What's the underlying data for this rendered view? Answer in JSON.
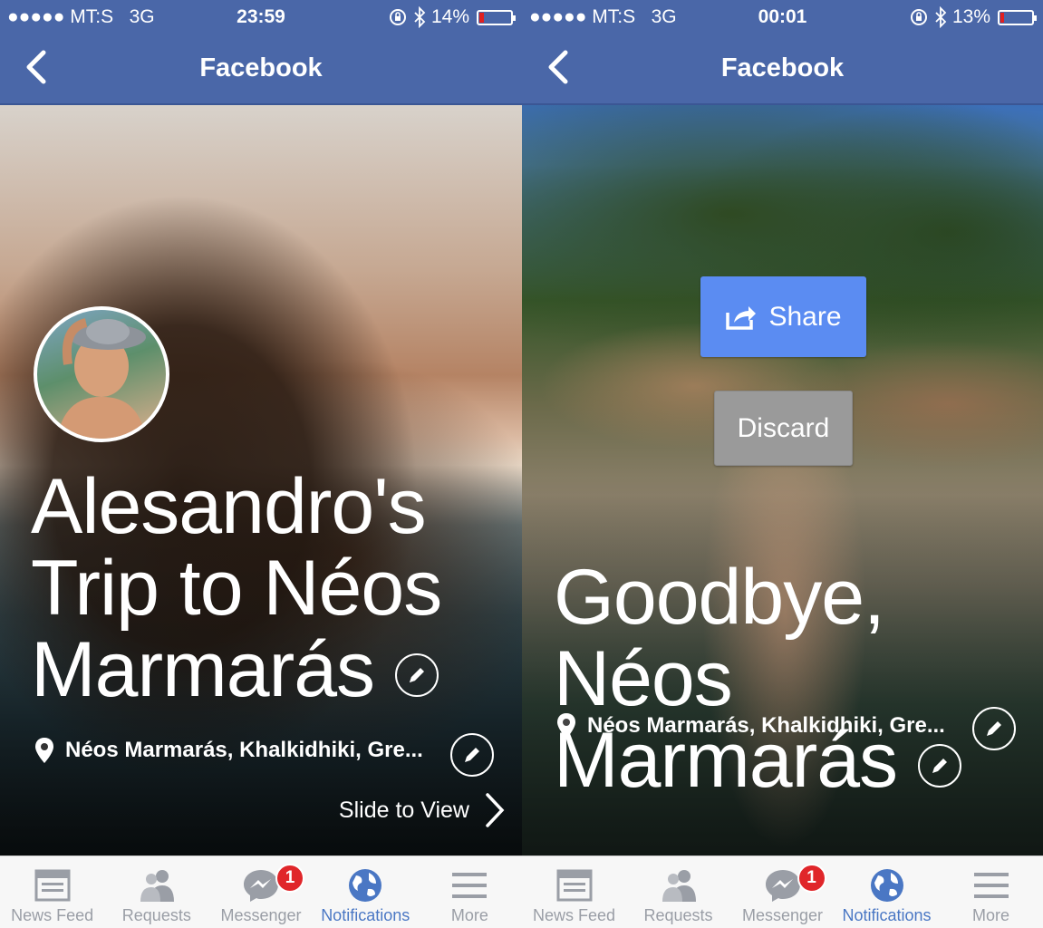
{
  "left_screen": {
    "status": {
      "carrier": "●●●●● MT:S",
      "network": "3G",
      "time": "23:59",
      "battery_text": "14%",
      "battery_level": 0.14
    },
    "nav": {
      "title": "Facebook"
    },
    "title_text": "Alesandro's Trip to Néos Marmarás",
    "location": "Néos Marmarás, Khalkidhiki, Gre...",
    "slide_label": "Slide to View",
    "tabs": [
      {
        "label": "News Feed",
        "icon": "news-feed-icon",
        "active": false
      },
      {
        "label": "Requests",
        "icon": "requests-icon",
        "active": false
      },
      {
        "label": "Messenger",
        "icon": "messenger-icon",
        "badge": "1",
        "active": false
      },
      {
        "label": "Notifications",
        "icon": "globe-icon",
        "active": true
      },
      {
        "label": "More",
        "icon": "menu-icon",
        "active": false
      }
    ]
  },
  "right_screen": {
    "status": {
      "carrier": "●●●●● MT:S",
      "network": "3G",
      "time": "00:01",
      "battery_text": "13%",
      "battery_level": 0.13
    },
    "nav": {
      "title": "Facebook"
    },
    "share_label": "Share",
    "discard_label": "Discard",
    "title_text": "Goodbye, Néos Marmarás",
    "location": "Néos Marmarás, Khalkidhiki, Gre...",
    "tabs": [
      {
        "label": "News Feed",
        "icon": "news-feed-icon",
        "active": false
      },
      {
        "label": "Requests",
        "icon": "requests-icon",
        "active": false
      },
      {
        "label": "Messenger",
        "icon": "messenger-icon",
        "badge": "1",
        "active": false
      },
      {
        "label": "Notifications",
        "icon": "globe-icon",
        "active": true
      },
      {
        "label": "More",
        "icon": "menu-icon",
        "active": false
      }
    ]
  },
  "colors": {
    "facebook_blue": "#4a67a8",
    "share_blue": "#5b8cf2",
    "active_tab": "#4a77c4",
    "badge_red": "#e0262a"
  }
}
